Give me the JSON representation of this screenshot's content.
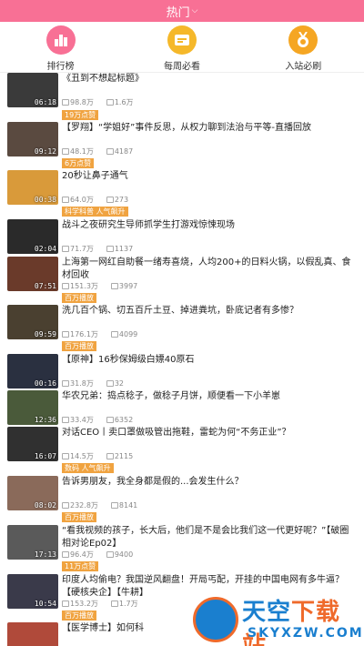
{
  "topbar": {
    "title": "热门",
    "chevron": "⌵"
  },
  "quicknav": [
    {
      "label": "排行榜",
      "icon": "ranking-icon",
      "color": "#f87095"
    },
    {
      "label": "每周必看",
      "icon": "weekly-icon",
      "color": "#f5b82a"
    },
    {
      "label": "入站必刷",
      "icon": "medal-icon",
      "color": "#f5a623"
    }
  ],
  "videos": [
    {
      "title": "《丑到不想起标题》",
      "duration": "06:18",
      "views": "98.8万",
      "comments": "1.6万",
      "tag": "19万点赞",
      "thumb": "#3a3a3a"
    },
    {
      "title": "【罗翔】“学姐好”事件反思，从权力聊到法治与平等-直播回放",
      "duration": "09:12",
      "views": "48.1万",
      "comments": "4187",
      "tag": "6万点赞",
      "thumb": "#5a4a40"
    },
    {
      "title": "20秒让鼻子通气",
      "duration": "00:38",
      "views": "64.0万",
      "comments": "273",
      "tag": "科学科普 人气飙升",
      "thumb": "#d99a3a"
    },
    {
      "title": "战斗之夜研究生导师抓学生打游戏惊悚现场",
      "duration": "02:04",
      "views": "71.7万",
      "comments": "1137",
      "tag": "",
      "thumb": "#2a2a2a"
    },
    {
      "title": "上海第一网红自助餐一绪寿喜烧，人均200+的日料火锅，以假乱真、食材回收",
      "duration": "07:51",
      "views": "151.3万",
      "comments": "3997",
      "tag": "百万播放",
      "thumb": "#6a3a2a"
    },
    {
      "title": "洗几百个锅、切五百斤土豆、掉进粪坑，卧底记者有多惨？",
      "duration": "09:59",
      "views": "176.1万",
      "comments": "4099",
      "tag": "百万播放",
      "thumb": "#4a4030"
    },
    {
      "title": "【原神】16秒保姆级白嫖40原石",
      "duration": "00:16",
      "views": "31.8万",
      "comments": "32",
      "tag": "",
      "thumb": "#2a3040"
    },
    {
      "title": "华农兄弟：捣点稔子，做稔子月饼，顺便看一下小羊崽",
      "duration": "12:36",
      "views": "33.4万",
      "comments": "6352",
      "tag": "",
      "thumb": "#4a5a3a"
    },
    {
      "title": "对话CEO丨卖口罩做吸管出拖鞋，雷蛇为何“不务正业”？",
      "duration": "16:07",
      "views": "14.5万",
      "comments": "2115",
      "tag": "数码 人气飙升",
      "thumb": "#303030"
    },
    {
      "title": "告诉男朋友，我全身都是假的...会发生什么？",
      "duration": "08:02",
      "views": "232.8万",
      "comments": "8141",
      "tag": "百万播放",
      "thumb": "#8a6a5a"
    },
    {
      "title": "“看我视频的孩子，长大后，他们是不是会比我们这一代更好呢？”【破圈相对论Ep02】",
      "duration": "17:13",
      "views": "96.4万",
      "comments": "9400",
      "tag": "11万点赞",
      "thumb": "#5a5a5a"
    },
    {
      "title": "印度人均偷电？我国逆风翻盘！开局丐配，开挂的中国电网有多牛逼？【硬核央企】【牛耕】",
      "duration": "10:54",
      "views": "153.2万",
      "comments": "1.7万",
      "tag": "百万播放",
      "thumb": "#3a3a4a"
    },
    {
      "title": "【医学博士】如何科",
      "duration": "",
      "views": "",
      "comments": "",
      "tag": "",
      "thumb": "#b04a3a"
    }
  ],
  "watermark": {
    "brand_a": "天空",
    "brand_b": "下载站",
    "sub": "SKYXZW.COM"
  }
}
